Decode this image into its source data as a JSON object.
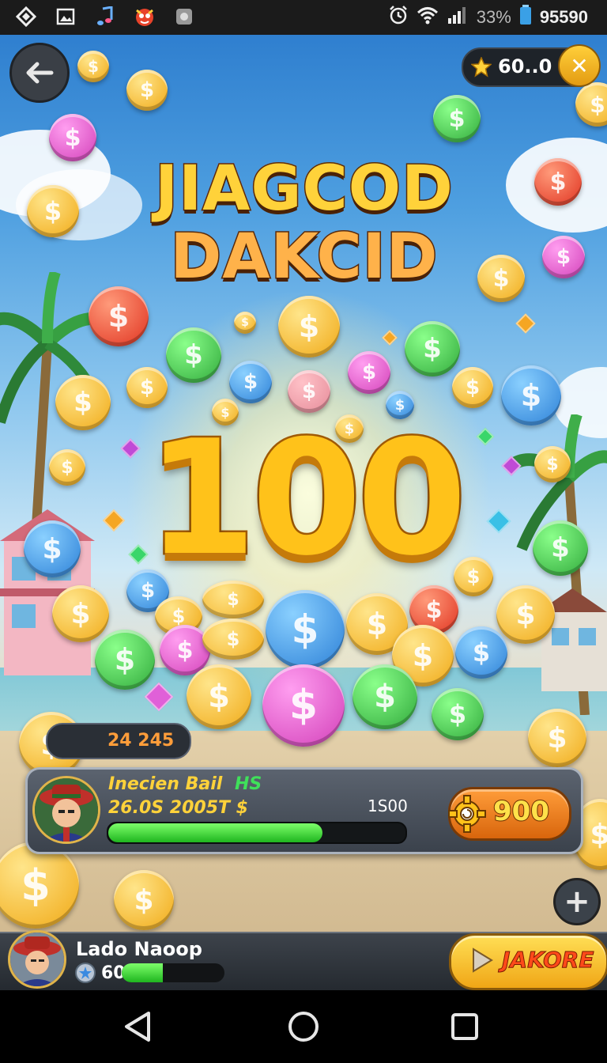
{
  "status_bar": {
    "battery_percent": "33%",
    "right_text": "95590",
    "icons": [
      "diamond-app-icon",
      "gallery-icon",
      "music-icon",
      "mascot-app-icon",
      "settings-app-icon",
      "alarm-icon",
      "wifi-icon",
      "signal-icon",
      "battery-icon"
    ]
  },
  "top": {
    "star_value": "60..0",
    "close_symbol": "✕"
  },
  "title": {
    "line1": "JIAGCOD",
    "line2": "DAKCID"
  },
  "reward": {
    "amount": "100"
  },
  "score_pill": {
    "value": "24 245"
  },
  "player_panel": {
    "name": "Inecien Bail",
    "tag": "HS",
    "amount": "26.0S 2005T $",
    "goal": "1S00",
    "progress_percent": 72,
    "button_value": "900"
  },
  "bottom_bar": {
    "player_name": "Lado Naoop",
    "level": "60",
    "level_progress_percent": 40,
    "button_label": "JAKORE"
  },
  "colors": {
    "coin_gold": "#f6b81e",
    "coin_green": "#35b53a",
    "coin_blue": "#2b8fe0",
    "coin_pink": "#e050c8",
    "coin_red": "#e8432a",
    "progress_green": "#1fb51f",
    "accent_orange": "#e8791a"
  }
}
